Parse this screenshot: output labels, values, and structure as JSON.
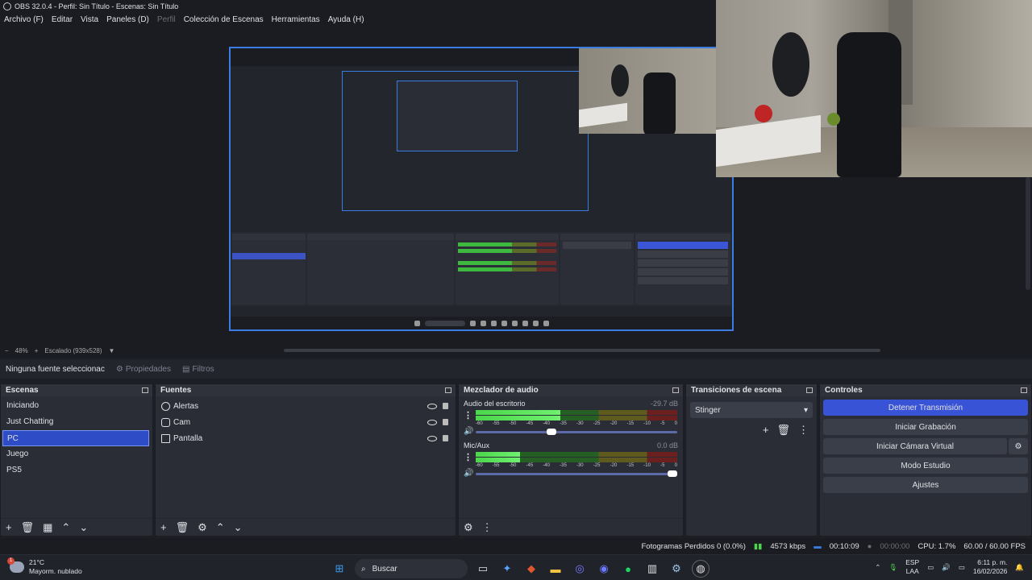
{
  "window": {
    "title": "OBS 32.0.4 - Perfil: Sin Título - Escenas: Sin Título"
  },
  "menu": [
    {
      "label": "Archivo (F)",
      "enabled": true
    },
    {
      "label": "Editar",
      "enabled": true
    },
    {
      "label": "Vista",
      "enabled": true
    },
    {
      "label": "Paneles (D)",
      "enabled": true
    },
    {
      "label": "Perfil",
      "enabled": false
    },
    {
      "label": "Colección de Escenas",
      "enabled": true
    },
    {
      "label": "Herramientas",
      "enabled": true
    },
    {
      "label": "Ayuda (H)",
      "enabled": true
    }
  ],
  "zoombar": {
    "minus": "−",
    "zoom": "48%",
    "plus": "+",
    "scale": "Escalado (939x528)",
    "caret": "▼"
  },
  "context": {
    "no_source": "Ninguna fuente seleccionac",
    "properties": "Propiedades",
    "filters": "Filtros"
  },
  "scenes": {
    "title": "Escenas",
    "items": [
      "Iniciando",
      "Just Chatting",
      "PC",
      "Juego",
      "PS5"
    ],
    "selected": "PC",
    "toolbar": [
      "+",
      "🗑",
      "▦",
      "⌃",
      "⌄"
    ]
  },
  "sources": {
    "title": "Fuentes",
    "items": [
      {
        "label": "Alertas",
        "icon": "globe-icon"
      },
      {
        "label": "Cam",
        "icon": "camera-icon"
      },
      {
        "label": "Pantalla",
        "icon": "monitor-icon"
      }
    ],
    "toolbar": [
      "+",
      "🗑",
      "⚙",
      "⌃",
      "⌄"
    ]
  },
  "mixer": {
    "title": "Mezclador de audio",
    "ticks": [
      "-60",
      "-55",
      "-50",
      "-45",
      "-40",
      "-35",
      "-30",
      "-25",
      "-20",
      "-15",
      "-10",
      "-5",
      "0"
    ],
    "tracks": [
      {
        "name": "Audio del escritorio",
        "db": "-29.7 dB",
        "level": 0.42,
        "volume": 0.37
      },
      {
        "name": "Mic/Aux",
        "db": "0.0 dB",
        "level": 0.22,
        "volume": 1.0
      }
    ]
  },
  "transitions": {
    "title": "Transiciones de escena",
    "selected": "Stinger"
  },
  "controls": {
    "title": "Controles",
    "buttons": [
      "Detener Transmisión",
      "Iniciar Grabación",
      "Iniciar Cámara Virtual",
      "Modo Estudio",
      "Ajustes"
    ]
  },
  "status": {
    "dropped": "Fotogramas Perdidos 0 (0.0%)",
    "bitrate": "4573 kbps",
    "stream_time": "00:10:09",
    "rec_time": "00:00:00",
    "cpu": "CPU: 1.7%",
    "fps": "60.00 / 60.00 FPS"
  },
  "taskbar": {
    "weather_temp": "21°C",
    "weather_desc": "Mayorm. nublado",
    "weather_badge": "1",
    "search": "Buscar",
    "lang1": "ESP",
    "lang2": "LAA",
    "time": "6:11 p. m.",
    "date": "16/02/2026"
  },
  "colors": {
    "accent": "#3953d6",
    "selected_scene": "#2e4cc5",
    "meter_green": "#4bd64b"
  }
}
